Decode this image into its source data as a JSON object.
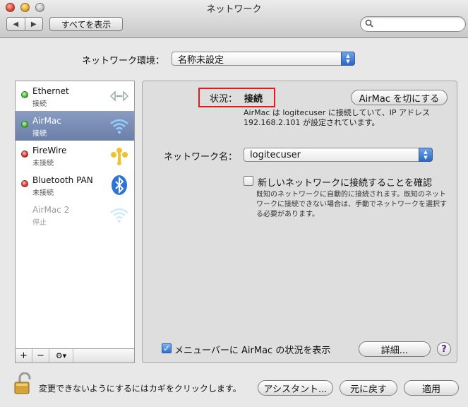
{
  "window": {
    "title": "ネットワーク"
  },
  "toolbar": {
    "back": "◀",
    "forward": "▶",
    "show_all": "すべてを表示",
    "search_placeholder": ""
  },
  "location": {
    "label": "ネットワーク環境：",
    "value": "名称未設定"
  },
  "services": [
    {
      "name": "Ethernet",
      "status": "接続",
      "dot": "green",
      "icon": "ethernet-icon"
    },
    {
      "name": "AirMac",
      "status": "接続",
      "dot": "green",
      "icon": "wifi-icon",
      "selected": true
    },
    {
      "name": "FireWire",
      "status": "未接続",
      "dot": "red",
      "icon": "firewire-icon"
    },
    {
      "name": "Bluetooth PAN",
      "status": "未接続",
      "dot": "red",
      "icon": "bluetooth-icon"
    },
    {
      "name": "AirMac 2",
      "status": "停止",
      "dot": "none",
      "icon": "wifi-icon"
    }
  ],
  "list_footer": {
    "add": "+",
    "remove": "−",
    "gear": "⚙▾"
  },
  "detail": {
    "status_label": "状況：",
    "status_value": "接続",
    "airmac_off_button": "AirMac を切にする",
    "description_line1": "AirMac は logitecuser に接続していて、IP アドレス",
    "description_line2": "192.168.2.101 が設定されています。",
    "network_name_label": "ネットワーク名：",
    "network_name_value": "logitecuser",
    "ask_join_label": "新しいネットワークに接続することを確認",
    "ask_join_desc_line1": "既知のネットワークに自動的に接続されます。既知のネット",
    "ask_join_desc_line2": "ワークに接続できない場合は、手動でネットワークを選択す",
    "ask_join_desc_line3": "る必要があります。",
    "menubar_label": "メニューバーに AirMac の状況を表示",
    "advanced_button": "詳細...",
    "help": "?"
  },
  "bottom": {
    "lock_label": "変更できないようにするにはカギをクリックします。",
    "assistant_button": "アシスタント...",
    "revert_button": "元に戻す",
    "apply_button": "適用"
  },
  "colors": {
    "selected_row": "#7a8db5",
    "status_highlight": "#e01b1b",
    "accent_blue": "#2a67c8"
  }
}
